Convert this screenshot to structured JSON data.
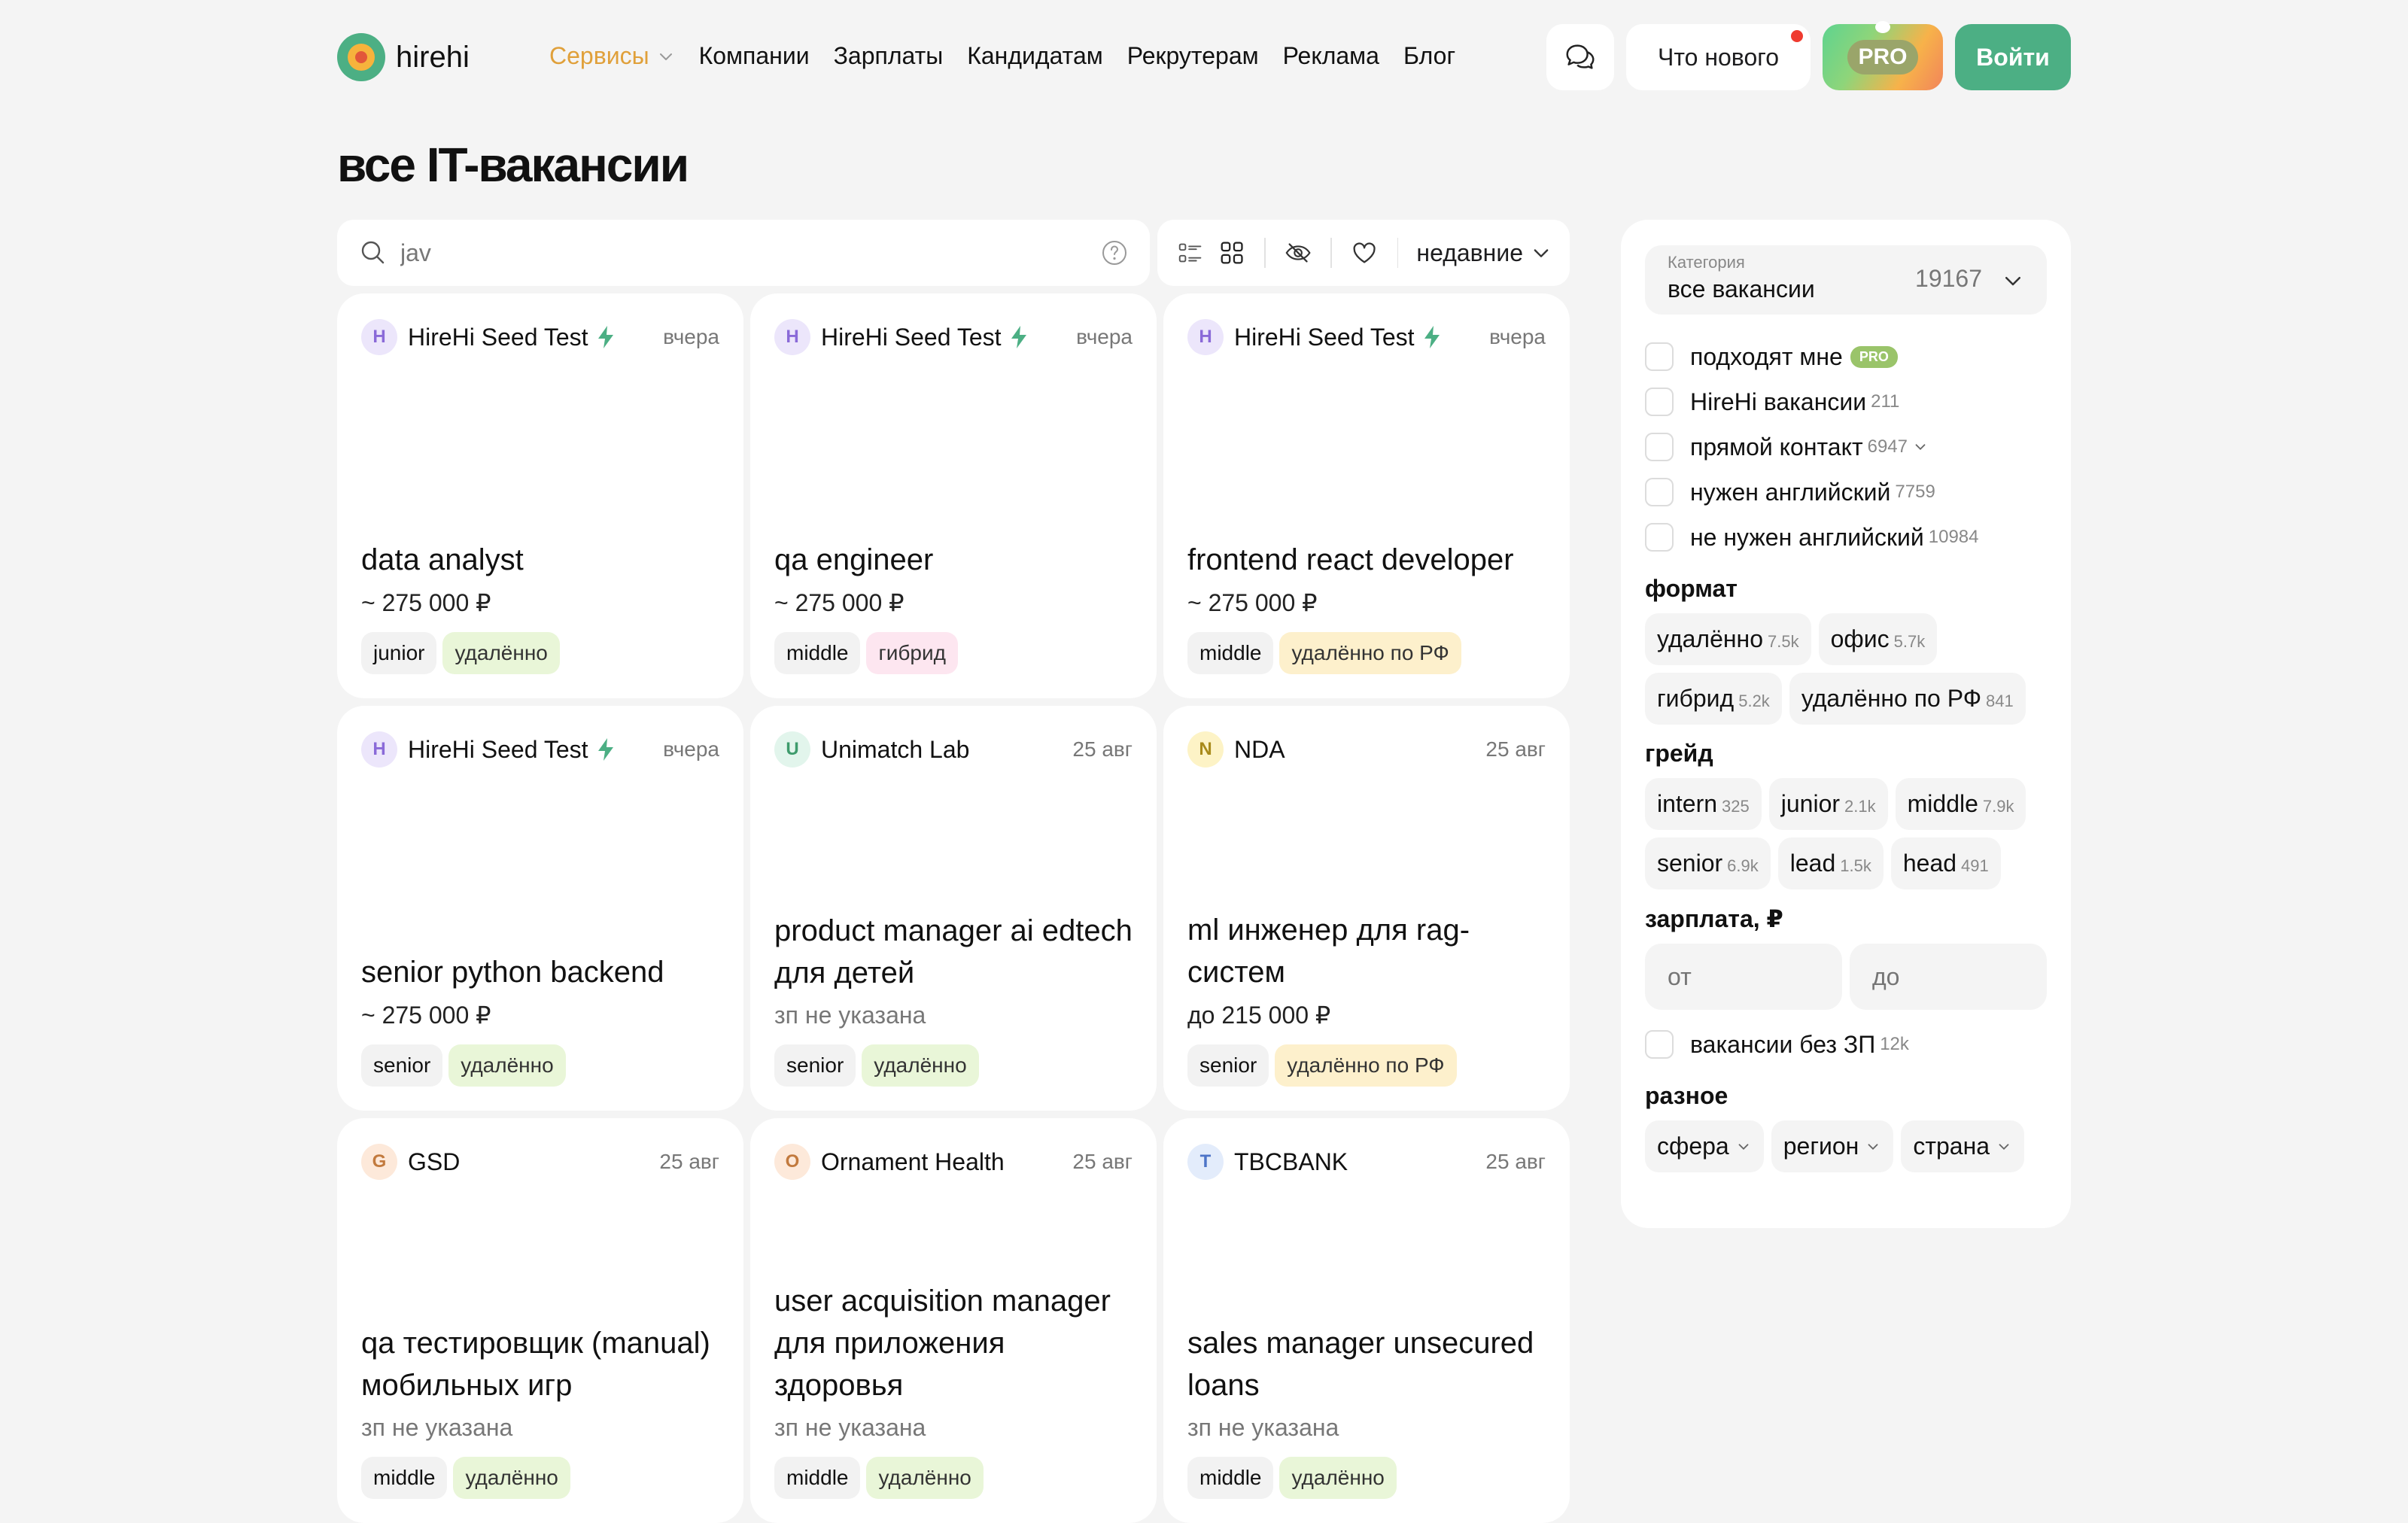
{
  "header": {
    "logo_text": "hirehi",
    "nav": {
      "services": "Сервисы",
      "companies": "Компании",
      "salaries": "Зарплаты",
      "candidates": "Кандидатам",
      "recruiters": "Рекрутерам",
      "ads": "Реклама",
      "blog": "Блог"
    },
    "whats_new": "Что нового",
    "pro": "PRO",
    "login": "Войти"
  },
  "page_title": "все IT-вакансии",
  "search": {
    "value": "jav"
  },
  "toolbar": {
    "sort_label": "недавние"
  },
  "cards": [
    {
      "badge": "H",
      "company": "HireHi Seed Test",
      "date": "вчера",
      "title": "data analyst",
      "salary": "~ 275 000 ₽",
      "tag1": "junior",
      "tag2": "удалённо"
    },
    {
      "badge": "H",
      "company": "HireHi Seed Test",
      "date": "вчера",
      "title": "qa engineer",
      "salary": "~ 275 000 ₽",
      "tag1": "middle",
      "tag2": "гибрид"
    },
    {
      "badge": "H",
      "company": "HireHi Seed Test",
      "date": "вчера",
      "title": "frontend react developer",
      "salary": "~ 275 000 ₽",
      "tag1": "middle",
      "tag2": "удалённо по РФ"
    },
    {
      "badge": "H",
      "company": "HireHi Seed Test",
      "date": "вчера",
      "title": "senior python backend",
      "salary": "~ 275 000 ₽",
      "tag1": "senior",
      "tag2": "удалённо"
    },
    {
      "badge": "U",
      "company": "Unimatch Lab",
      "date": "25 авг",
      "title": "product manager ai edtech для детей",
      "salary": "зп не указана",
      "tag1": "senior",
      "tag2": "удалённо"
    },
    {
      "badge": "N",
      "company": "NDA",
      "date": "25 авг",
      "title": "ml инженер для rag-систем",
      "salary": "до 215 000 ₽",
      "tag1": "senior",
      "tag2": "удалённо по РФ"
    },
    {
      "badge": "G",
      "company": "GSD",
      "date": "25 авг",
      "title": "qa тестировщик (manual) мобильных игр",
      "salary": "зп не указана",
      "tag1": "middle",
      "tag2": "удалённо"
    },
    {
      "badge": "O",
      "company": "Ornament Health",
      "date": "25 авг",
      "title": "user acquisition manager для приложения здоровья",
      "salary": "зп не указана",
      "tag1": "middle",
      "tag2": "удалённо"
    },
    {
      "badge": "T",
      "company": "TBCBANK",
      "date": "25 авг",
      "title": "sales manager unsecured loans",
      "salary": "зп не указана",
      "tag1": "middle",
      "tag2": "удалённо"
    }
  ],
  "sidebar": {
    "category_label": "Категория",
    "category_value": "все вакансии",
    "category_count": "19167",
    "checks": [
      {
        "label": "подходят мне",
        "count": "",
        "pro": "PRO"
      },
      {
        "label": "HireHi вакансии",
        "count": "211"
      },
      {
        "label": "прямой контакт",
        "count": "6947"
      },
      {
        "label": "нужен английский",
        "count": "7759"
      },
      {
        "label": "не нужен английский",
        "count": "10984"
      }
    ],
    "format_title": "формат",
    "format": [
      {
        "label": "удалённо",
        "count": "7.5k"
      },
      {
        "label": "офис",
        "count": "5.7k"
      },
      {
        "label": "гибрид",
        "count": "5.2k"
      },
      {
        "label": "удалённо по РФ",
        "count": "841"
      }
    ],
    "grade_title": "грейд",
    "grade": [
      {
        "label": "intern",
        "count": "325"
      },
      {
        "label": "junior",
        "count": "2.1k"
      },
      {
        "label": "middle",
        "count": "7.9k"
      },
      {
        "label": "senior",
        "count": "6.9k"
      },
      {
        "label": "lead",
        "count": "1.5k"
      },
      {
        "label": "head",
        "count": "491"
      }
    ],
    "salary_title": "зарплата, ₽",
    "salary_from": "от",
    "salary_to": "до",
    "no_salary": {
      "label": "вакансии без ЗП",
      "count": "12k"
    },
    "misc_title": "разное",
    "misc": [
      "сфера",
      "регион",
      "страна"
    ]
  },
  "colors": {
    "brand": "#4caf84",
    "accent": "#e0a03a",
    "remote_tag": "#e9f6d8",
    "hybrid_tag": "#fde6f0",
    "rf_tag": "#fdf0cc"
  }
}
